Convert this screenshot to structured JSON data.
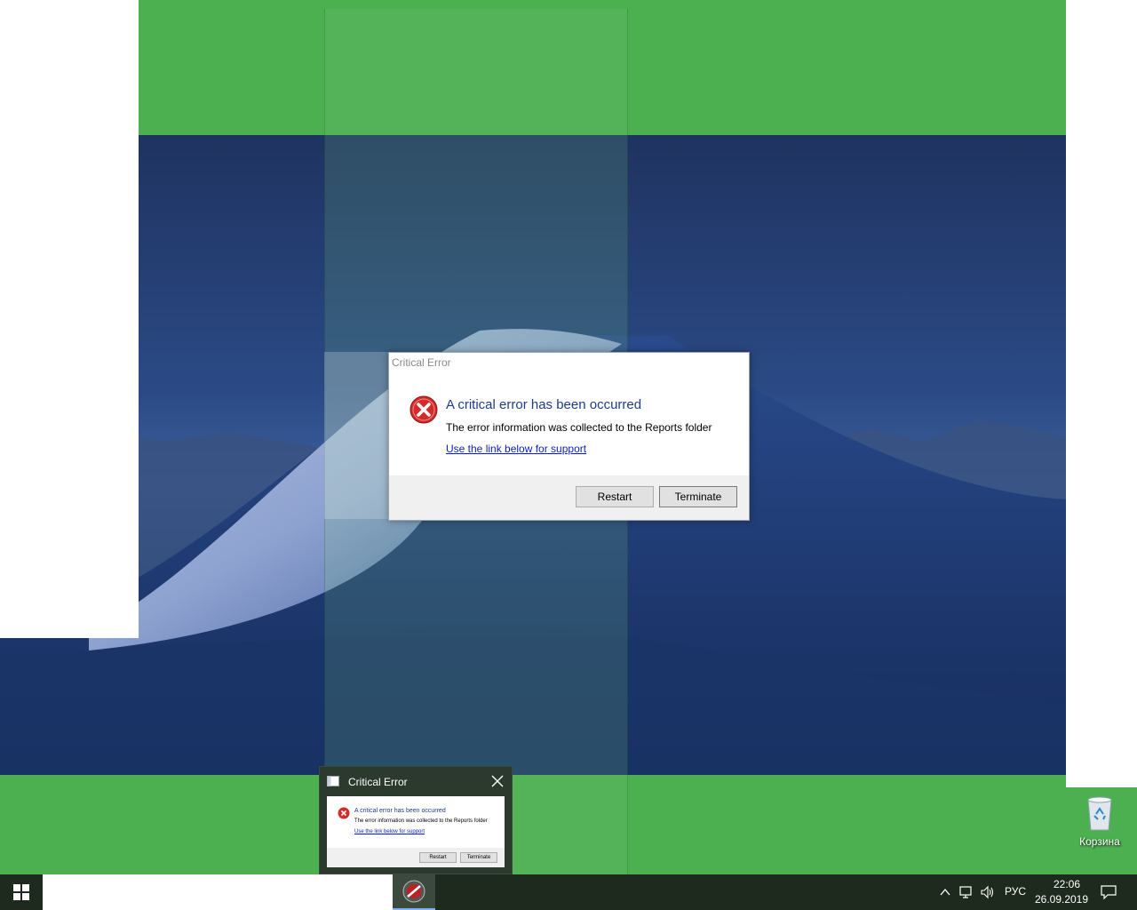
{
  "dialog": {
    "title": "Critical Error",
    "heading": "A critical error has been occurred",
    "message": "The error information was collected to the Reports folder",
    "link": "Use the link below for support",
    "restart_label": "Restart",
    "terminate_label": "Terminate",
    "icon": "error-icon"
  },
  "taskbar_preview": {
    "title": "Critical Error",
    "heading": "A critical error has been occurred",
    "message": "The error information was collected to the Reports folder",
    "link": "Use the link below for support",
    "restart_label": "Restart",
    "terminate_label": "Terminate"
  },
  "desktop": {
    "recycle_bin_label": "Корзина"
  },
  "tray": {
    "language": "РУС",
    "time": "22:06",
    "date": "26.09.2019",
    "icons": [
      "chevron-up-icon",
      "network-icon",
      "volume-icon",
      "notification-icon"
    ]
  },
  "colors": {
    "background_green": "#4caf50",
    "taskbar": "#1f2a1f",
    "heading_blue": "#1e3c8c",
    "link_blue": "#0a1ebe",
    "error_red": "#d42a2a"
  }
}
